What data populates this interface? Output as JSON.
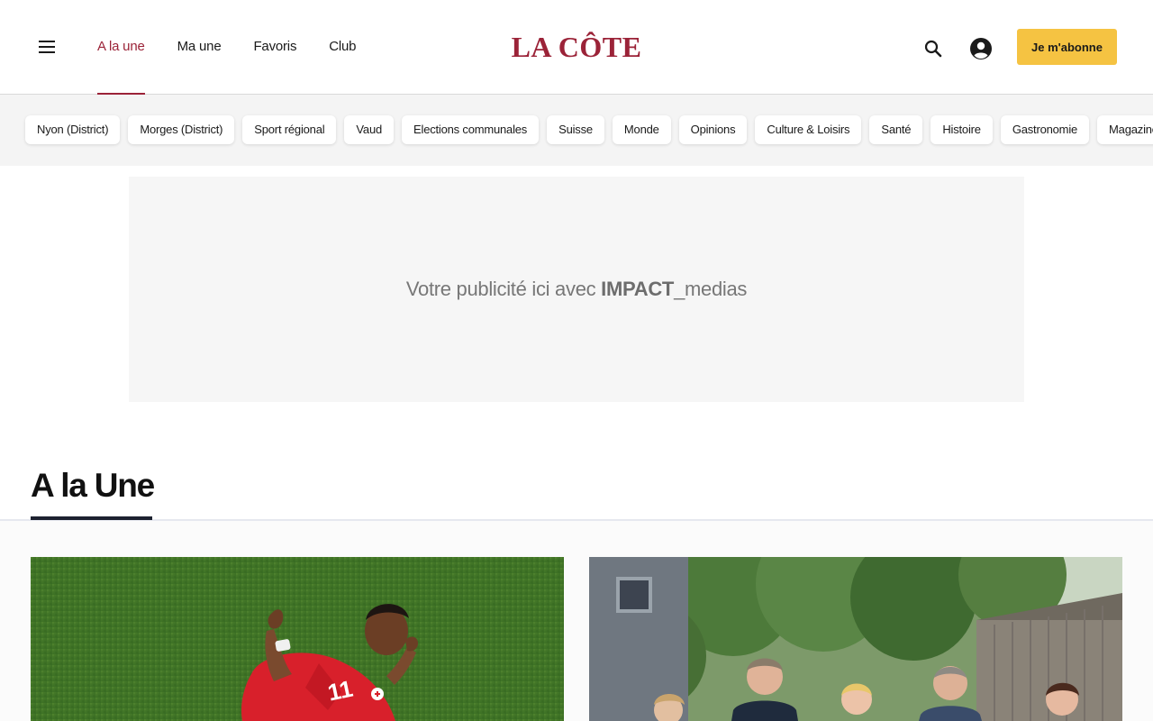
{
  "header": {
    "menu_icon": "hamburger-menu-icon",
    "nav": [
      {
        "label": "A la une",
        "active": true
      },
      {
        "label": "Ma une",
        "active": false
      },
      {
        "label": "Favoris",
        "active": false
      },
      {
        "label": "Club",
        "active": false
      }
    ],
    "logo": "LA CÔTE",
    "search_icon": "search-icon",
    "account_icon": "account-circle-icon",
    "subscribe_label": "Je m'abonne"
  },
  "categories": [
    "Nyon (District)",
    "Morges (District)",
    "Sport régional",
    "Vaud",
    "Elections communales",
    "Suisse",
    "Monde",
    "Opinions",
    "Culture & Loisirs",
    "Santé",
    "Histoire",
    "Gastronomie",
    "Magazine"
  ],
  "ad": {
    "text_prefix": "Votre publicité ici avec ",
    "brand_bold": "IMPACT",
    "brand_suffix": "_medias"
  },
  "section": {
    "title": "A la Une"
  },
  "colors": {
    "brand": "#9b2338",
    "subscribe_bg": "#f5c342",
    "strip_bg": "#f4f4f4"
  }
}
